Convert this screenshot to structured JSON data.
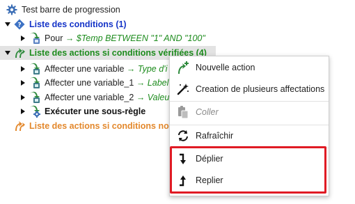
{
  "tree": {
    "root_label": "Test barre de progression",
    "conditions_label": "Liste des conditions (1)",
    "condition_item": {
      "field": "Pour",
      "detail": "→ $Temp BETWEEN \"1\" AND \"100\""
    },
    "actions_label": "Liste des actions si conditions vérifiées (4)",
    "actions": [
      {
        "label": "Affecter une variable",
        "detail": "→ Type d'i"
      },
      {
        "label": "Affecter une variable_1",
        "detail": "→ Label d"
      },
      {
        "label": "Affecter une variable_2",
        "detail": "→ Valeur"
      }
    ],
    "subrule_label": "Exécuter une sous-règle",
    "else_actions_label": "Liste des actions si conditions non"
  },
  "context_menu": {
    "new_action": "Nouvelle action",
    "multi_assign": "Creation de plusieurs affectations",
    "paste": "Coller",
    "refresh": "Rafraîchir",
    "expand": "Déplier",
    "collapse": "Replier"
  },
  "colors": {
    "conditions": "#1534c8",
    "actions": "#1e8c1e",
    "else_actions": "#e3882c",
    "highlight": "#e01b24",
    "gear": "#3d6fb6"
  }
}
